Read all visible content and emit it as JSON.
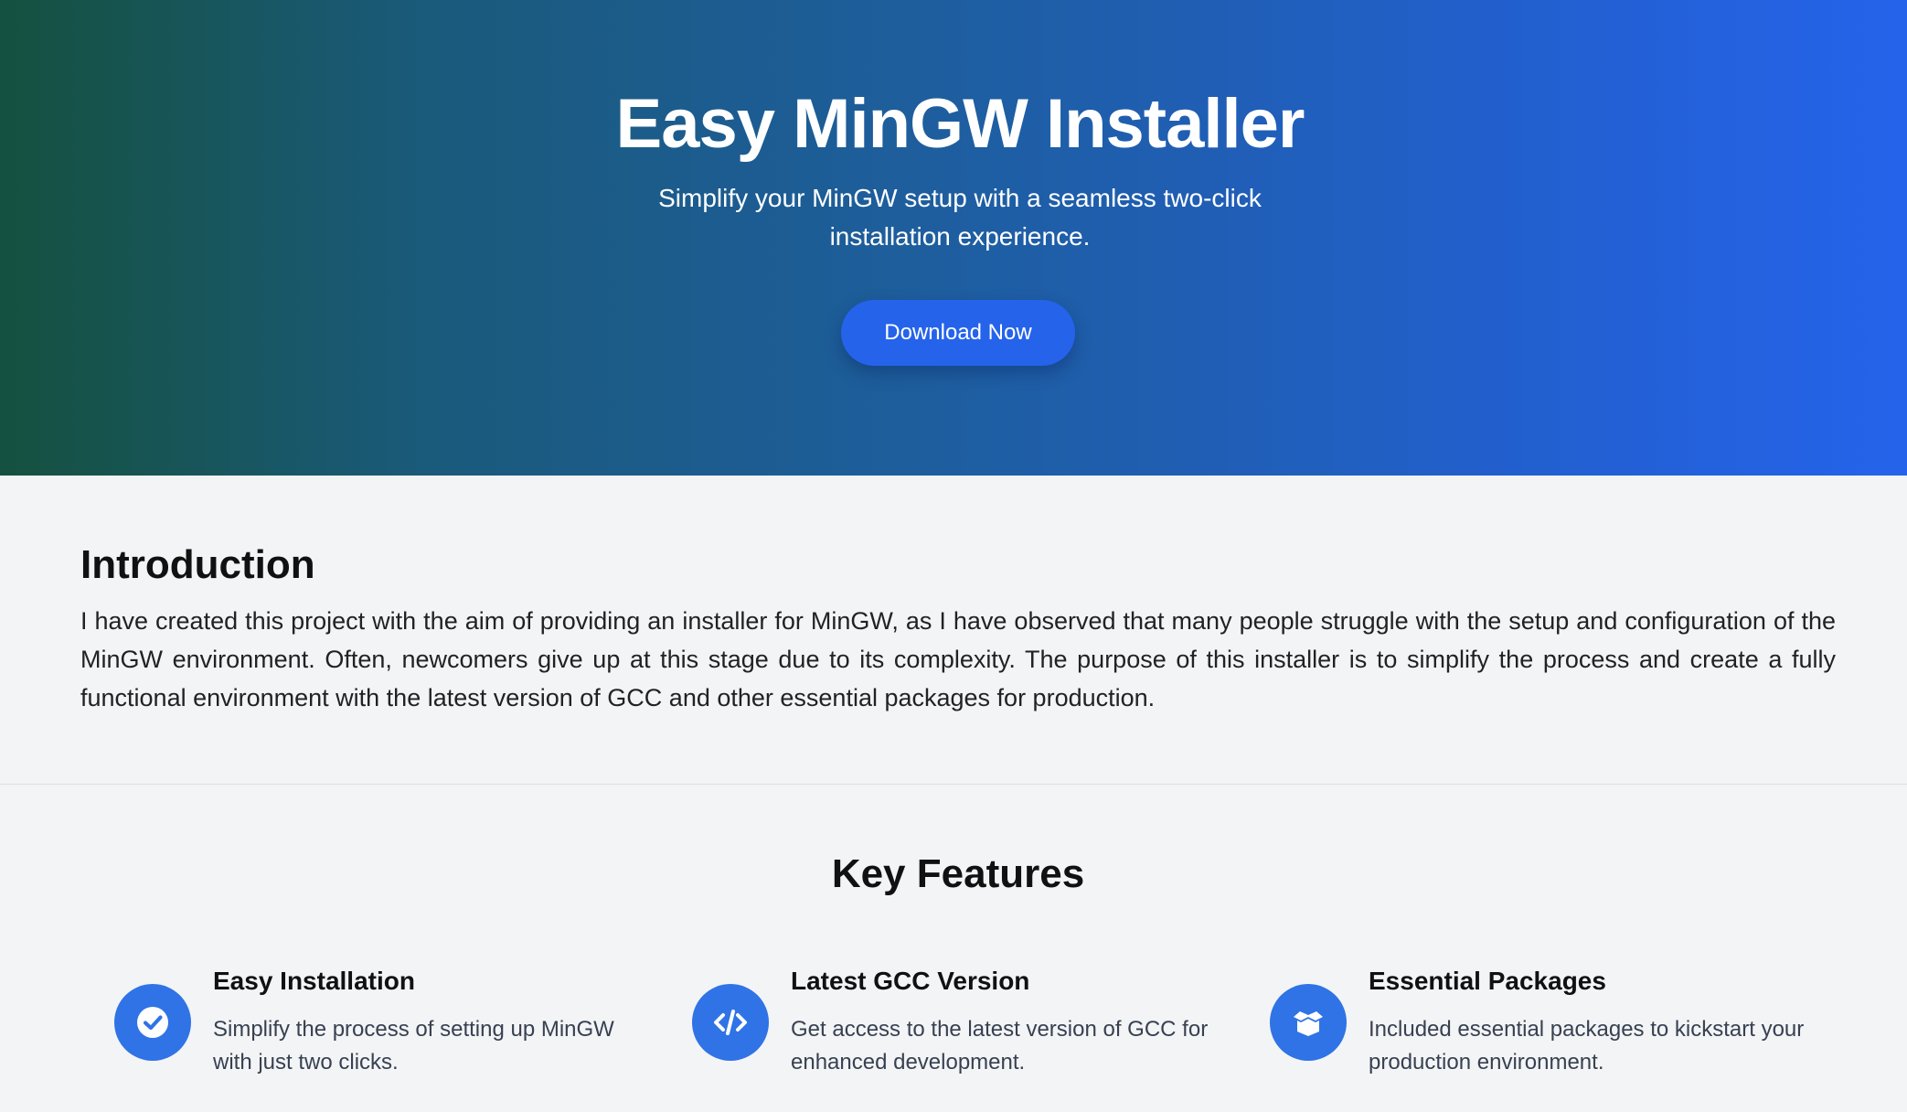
{
  "hero": {
    "title": "Easy MinGW Installer",
    "subtitle": "Simplify your MinGW setup with a seamless two-click installation experience.",
    "download_label": "Download Now"
  },
  "intro": {
    "heading": "Introduction",
    "body": "I have created this project with the aim of providing an installer for MinGW, as I have observed that many people struggle with the setup and configuration of the MinGW environment. Often, newcomers give up at this stage due to its complexity. The purpose of this installer is to simplify the process and create a fully functional environment with the latest version of GCC and other essential packages for production."
  },
  "features": {
    "heading": "Key Features",
    "items": [
      {
        "icon": "check-circle-icon",
        "title": "Easy Installation",
        "description": "Simplify the process of setting up MinGW with just two clicks."
      },
      {
        "icon": "code-icon",
        "title": "Latest GCC Version",
        "description": "Get access to the latest version of GCC for enhanced development."
      },
      {
        "icon": "box-open-icon",
        "title": "Essential Packages",
        "description": "Included essential packages to kickstart your production environment."
      }
    ]
  },
  "colors": {
    "accent": "#2563eb",
    "icon_circle": "#2f73e6",
    "hero_gradient_start": "#15513f",
    "hero_gradient_end": "#2563eb",
    "page_background": "#f3f4f6"
  }
}
